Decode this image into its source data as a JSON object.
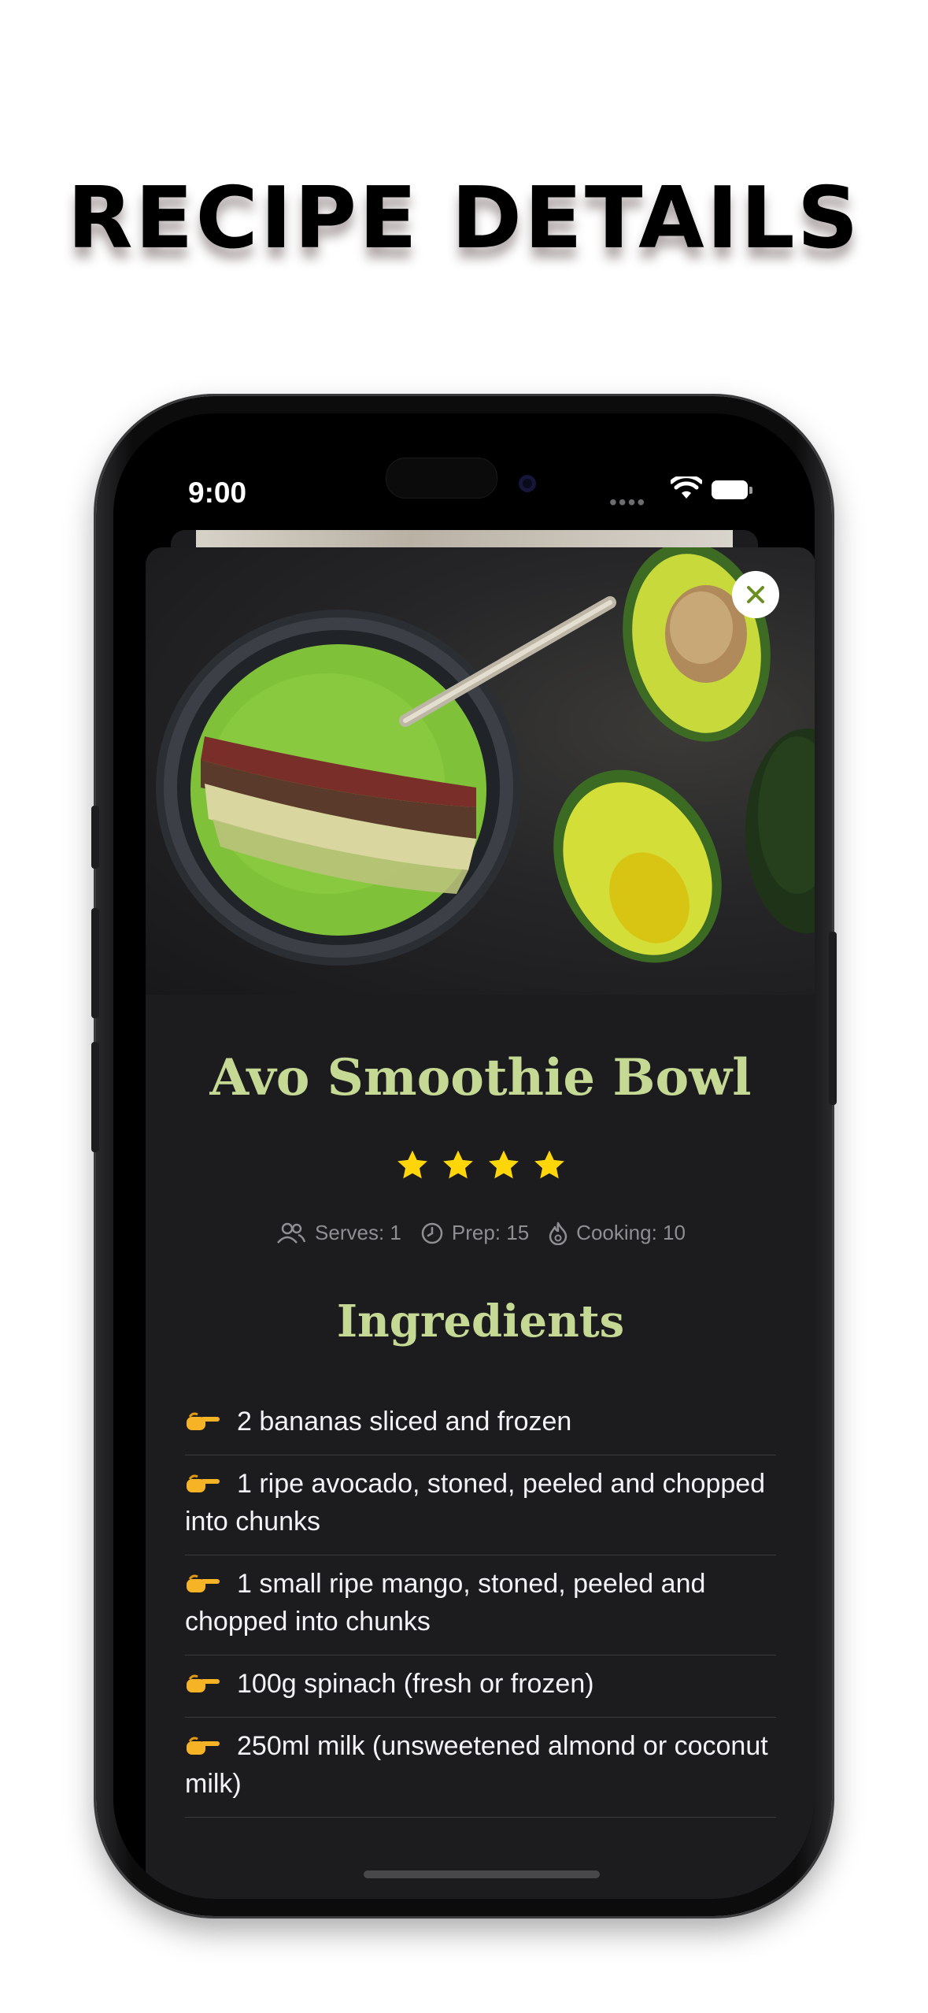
{
  "headline": "RECIPE DETAILS",
  "status_bar": {
    "time": "9:00"
  },
  "recipe": {
    "title": "Avo Smoothie Bowl",
    "rating": 4,
    "meta": {
      "serves": "Serves: 1",
      "prep": "Prep: 15",
      "cooking": "Cooking: 10"
    },
    "ingredients_title": "Ingredients",
    "ingredients": [
      "2 bananas sliced and frozen",
      "1 ripe avocado, stoned, peeled and chopped into chunks",
      "1 small ripe mango, stoned, peeled and chopped into chunks",
      "100g spinach (fresh or frozen)",
      "250ml milk (unsweetened almond or coconut milk)"
    ]
  },
  "colors": {
    "accent": "#c5d894",
    "star": "#ffd60a",
    "sheet": "#1c1c1e",
    "close_icon": "#6b8e23"
  }
}
